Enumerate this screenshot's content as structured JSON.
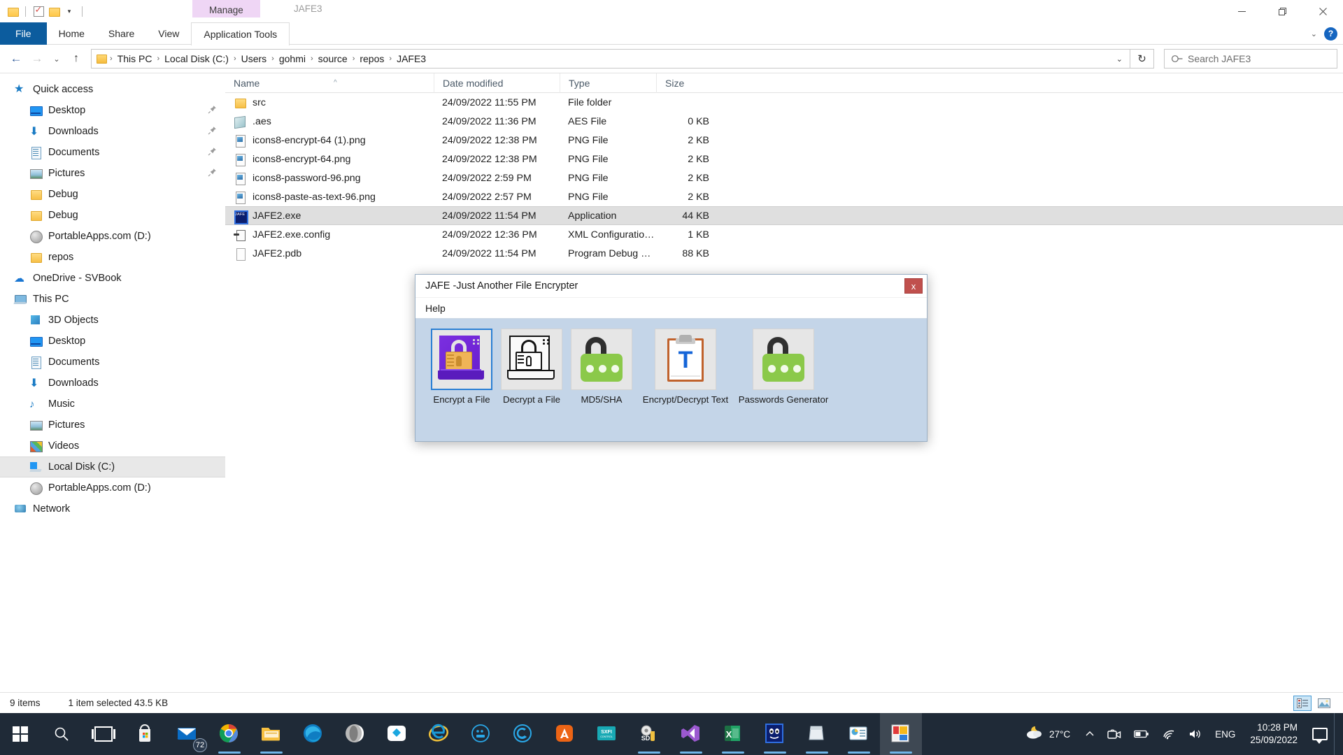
{
  "window": {
    "app_title": "JAFE3",
    "quick_access_toolbar": {
      "folder_icon": "folder-icon",
      "properties_icon": "properties-checkbox-icon",
      "new_folder_icon": "new-folder-icon",
      "customize_caret": "▾"
    },
    "context_tab": "Manage",
    "controls": {
      "minimize": "–",
      "maximize": "❐",
      "close": "✕"
    }
  },
  "ribbon": {
    "tabs": [
      "File",
      "Home",
      "Share",
      "View"
    ],
    "contextual_tab": "Application Tools",
    "collapse_caret": "⌄",
    "help_label": "?"
  },
  "address": {
    "back": "←",
    "forward": "→",
    "recent": "⌄",
    "up": "↑",
    "breadcrumbs": [
      "This PC",
      "Local Disk (C:)",
      "Users",
      "gohmi",
      "source",
      "repos",
      "JAFE3"
    ],
    "separator": "›",
    "dropdown_caret": "⌄",
    "refresh_icon": "refresh-icon",
    "refresh_glyph": "↻"
  },
  "search": {
    "placeholder": "Search JAFE3",
    "icon": "search-icon"
  },
  "navpane": {
    "groups": [
      {
        "label": "Quick access",
        "icon": "star-icon",
        "level": 0,
        "pin": false,
        "selected": false,
        "icon_class": "ic-star",
        "glyph": "★"
      },
      {
        "label": "Desktop",
        "icon": "desktop-icon",
        "level": 1,
        "pin": true,
        "selected": false,
        "icon_class": "ic-desktop",
        "glyph": ""
      },
      {
        "label": "Downloads",
        "icon": "downloads-icon",
        "level": 1,
        "pin": true,
        "selected": false,
        "icon_class": "ic-dl",
        "glyph": "⬇"
      },
      {
        "label": "Documents",
        "icon": "documents-icon",
        "level": 1,
        "pin": true,
        "selected": false,
        "icon_class": "ic-doc",
        "glyph": ""
      },
      {
        "label": "Pictures",
        "icon": "pictures-icon",
        "level": 1,
        "pin": true,
        "selected": false,
        "icon_class": "ic-pic",
        "glyph": ""
      },
      {
        "label": "Debug",
        "icon": "folder-icon",
        "level": 1,
        "pin": false,
        "selected": false,
        "icon_class": "ic-folder",
        "glyph": ""
      },
      {
        "label": "Debug",
        "icon": "folder-icon",
        "level": 1,
        "pin": false,
        "selected": false,
        "icon_class": "ic-folder",
        "glyph": ""
      },
      {
        "label": "PortableApps.com (D:)",
        "icon": "disc-drive-icon",
        "level": 1,
        "pin": false,
        "selected": false,
        "icon_class": "ic-disc",
        "glyph": ""
      },
      {
        "label": "repos",
        "icon": "folder-icon",
        "level": 1,
        "pin": false,
        "selected": false,
        "icon_class": "ic-folder",
        "glyph": ""
      },
      {
        "label": "OneDrive - SVBook",
        "icon": "onedrive-cloud-icon",
        "level": 0,
        "pin": false,
        "selected": false,
        "icon_class": "ic-cloud",
        "glyph": "☁"
      },
      {
        "label": "This PC",
        "icon": "this-pc-icon",
        "level": 0,
        "pin": false,
        "selected": false,
        "icon_class": "ic-pc",
        "glyph": ""
      },
      {
        "label": "3D Objects",
        "icon": "3d-objects-icon",
        "level": 1,
        "pin": false,
        "selected": false,
        "icon_class": "ic-3d",
        "glyph": ""
      },
      {
        "label": "Desktop",
        "icon": "desktop-icon",
        "level": 1,
        "pin": false,
        "selected": false,
        "icon_class": "ic-desktop",
        "glyph": ""
      },
      {
        "label": "Documents",
        "icon": "documents-icon",
        "level": 1,
        "pin": false,
        "selected": false,
        "icon_class": "ic-doc",
        "glyph": ""
      },
      {
        "label": "Downloads",
        "icon": "downloads-icon",
        "level": 1,
        "pin": false,
        "selected": false,
        "icon_class": "ic-dl",
        "glyph": "⬇"
      },
      {
        "label": "Music",
        "icon": "music-icon",
        "level": 1,
        "pin": false,
        "selected": false,
        "icon_class": "ic-music",
        "glyph": "♪"
      },
      {
        "label": "Pictures",
        "icon": "pictures-icon",
        "level": 1,
        "pin": false,
        "selected": false,
        "icon_class": "ic-pic",
        "glyph": ""
      },
      {
        "label": "Videos",
        "icon": "videos-icon",
        "level": 1,
        "pin": false,
        "selected": false,
        "icon_class": "ic-video",
        "glyph": ""
      },
      {
        "label": "Local Disk (C:)",
        "icon": "hard-disk-icon",
        "level": 1,
        "pin": false,
        "selected": true,
        "icon_class": "ic-hdd",
        "glyph": ""
      },
      {
        "label": "PortableApps.com (D:)",
        "icon": "disc-drive-icon",
        "level": 1,
        "pin": false,
        "selected": false,
        "icon_class": "ic-disc",
        "glyph": ""
      },
      {
        "label": "Network",
        "icon": "network-icon",
        "level": 0,
        "pin": false,
        "selected": false,
        "icon_class": "ic-net",
        "glyph": ""
      }
    ],
    "pin_glyph": "📌"
  },
  "filelist": {
    "columns": [
      "Name",
      "Date modified",
      "Type",
      "Size"
    ],
    "sort_indicator": "^",
    "rows": [
      {
        "name": "src",
        "date": "24/09/2022 11:55 PM",
        "type": "File folder",
        "size": "",
        "icon": "folder-icon",
        "icon_class": "fi-folder",
        "selected": false
      },
      {
        "name": ".aes",
        "date": "24/09/2022 11:36 PM",
        "type": "AES File",
        "size": "0 KB",
        "icon": "aes-file-icon",
        "icon_class": "fi-aes",
        "selected": false
      },
      {
        "name": "icons8-encrypt-64 (1).png",
        "date": "24/09/2022 12:38 PM",
        "type": "PNG File",
        "size": "2 KB",
        "icon": "png-file-icon",
        "icon_class": "fi-png",
        "selected": false
      },
      {
        "name": "icons8-encrypt-64.png",
        "date": "24/09/2022 12:38 PM",
        "type": "PNG File",
        "size": "2 KB",
        "icon": "png-file-icon",
        "icon_class": "fi-png",
        "selected": false
      },
      {
        "name": "icons8-password-96.png",
        "date": "24/09/2022 2:59 PM",
        "type": "PNG File",
        "size": "2 KB",
        "icon": "png-file-icon",
        "icon_class": "fi-png",
        "selected": false
      },
      {
        "name": "icons8-paste-as-text-96.png",
        "date": "24/09/2022 2:57 PM",
        "type": "PNG File",
        "size": "2 KB",
        "icon": "png-file-icon",
        "icon_class": "fi-png",
        "selected": false
      },
      {
        "name": "JAFE2.exe",
        "date": "24/09/2022 11:54 PM",
        "type": "Application",
        "size": "44 KB",
        "icon": "application-exe-icon",
        "icon_class": "fi-exe",
        "selected": true
      },
      {
        "name": "JAFE2.exe.config",
        "date": "24/09/2022 12:36 PM",
        "type": "XML Configuration...",
        "size": "1 KB",
        "icon": "xml-config-icon",
        "icon_class": "fi-cfg",
        "selected": false
      },
      {
        "name": "JAFE2.pdb",
        "date": "24/09/2022 11:54 PM",
        "type": "Program Debug D...",
        "size": "88 KB",
        "icon": "pdb-file-icon",
        "icon_class": "fi-pdb",
        "selected": false
      }
    ]
  },
  "statusbar": {
    "item_count": "9 items",
    "selection": "1 item selected  43.5 KB",
    "view_details_icon": "details-view-icon",
    "view_thumbnails_icon": "large-icons-view-icon"
  },
  "dialog": {
    "title": "JAFE -Just Another File Encrypter",
    "close_label": "x",
    "menu": [
      "Help"
    ],
    "buttons": [
      {
        "label": "Encrypt a File",
        "icon": "encrypt-file-icon",
        "selected": true
      },
      {
        "label": "Decrypt a File",
        "icon": "decrypt-file-icon",
        "selected": false
      },
      {
        "label": "MD5/SHA",
        "icon": "hash-padlock-icon",
        "selected": false
      },
      {
        "label": "Encrypt/Decrypt Text",
        "icon": "clipboard-text-icon",
        "selected": false
      },
      {
        "label": "Passwords Generator",
        "icon": "password-padlock-icon",
        "selected": false
      }
    ]
  },
  "taskbar": {
    "start_icon": "windows-start-icon",
    "search_icon": "search-icon",
    "taskview_icon": "task-view-icon",
    "apps": [
      {
        "name": "microsoft-store-icon",
        "badge": "",
        "running": false,
        "active": false
      },
      {
        "name": "mail-icon",
        "badge": "72",
        "running": false,
        "active": false
      },
      {
        "name": "google-chrome-icon",
        "badge": "",
        "running": true,
        "active": false
      },
      {
        "name": "file-explorer-icon",
        "badge": "",
        "running": true,
        "active": false
      },
      {
        "name": "microsoft-edge-icon",
        "badge": "",
        "running": false,
        "active": false
      },
      {
        "name": "opera-gx-icon",
        "badge": "",
        "running": false,
        "active": false
      },
      {
        "name": "dropbox-icon",
        "badge": "",
        "running": false,
        "active": false
      },
      {
        "name": "internet-explorer-icon",
        "badge": "",
        "running": false,
        "active": false
      },
      {
        "name": "blackberry-icon",
        "badge": "",
        "running": false,
        "active": false
      },
      {
        "name": "creative-icon",
        "badge": "",
        "running": false,
        "active": false
      },
      {
        "name": "avira-icon",
        "badge": "",
        "running": false,
        "active": false
      },
      {
        "name": "sxfi-control-icon",
        "badge": "",
        "running": false,
        "active": false
      },
      {
        "name": "sd-tool-icon",
        "badge": "",
        "running": true,
        "active": false
      },
      {
        "name": "visual-studio-icon",
        "badge": "",
        "running": true,
        "active": false
      },
      {
        "name": "excel-icon",
        "badge": "",
        "running": true,
        "active": false
      },
      {
        "name": "jafe-app-icon",
        "badge": "",
        "running": true,
        "active": false
      },
      {
        "name": "notepad-icon",
        "badge": "",
        "running": true,
        "active": false
      },
      {
        "name": "powerpoint-like-icon",
        "badge": "",
        "running": true,
        "active": false
      },
      {
        "name": "paint-app-icon",
        "badge": "",
        "running": true,
        "active": true
      }
    ],
    "tray": {
      "weather_icon": "moon-cloud-icon",
      "weather_glyph": "🌙",
      "temperature": "27°C",
      "overflow_caret": "⌃",
      "camera_icon": "camera-icon",
      "battery_icon": "battery-icon",
      "wifi_icon": "wifi-icon",
      "volume_icon": "volume-icon",
      "language": "ENG",
      "time": "10:28 PM",
      "date": "25/09/2022",
      "action_center_icon": "action-center-icon"
    }
  },
  "colors": {
    "file_tab_blue": "#0c5c9e",
    "manage_tab_purple": "#efd6f5",
    "selection_gray": "#dfdfdf",
    "dialog_bg": "#c4d5e8",
    "dialog_close_red": "#c0504d",
    "taskbar_bg": "#1f2a37",
    "encrypt_icon_purple": "#6a1fd0",
    "padlock_green": "#8bc94a"
  }
}
